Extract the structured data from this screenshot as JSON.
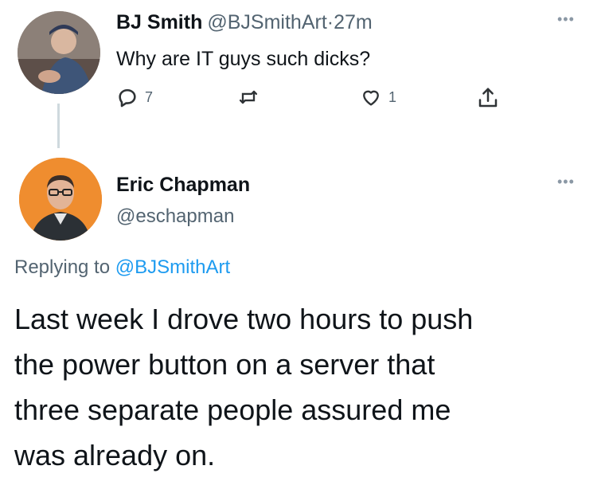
{
  "tweet1": {
    "author_name": "BJ Smith",
    "author_handle": "@BJSmithArt",
    "separator": "·",
    "time": "27m",
    "text": "Why are IT guys such dicks?",
    "more_glyph": "•••",
    "actions": {
      "reply_count": "7",
      "retweet_count": "",
      "like_count": "1",
      "reply_icon": "reply-icon",
      "retweet_icon": "retweet-icon",
      "like_icon": "heart-icon",
      "share_icon": "share-icon"
    }
  },
  "tweet2": {
    "author_name": "Eric Chapman",
    "author_handle": "@eschapman",
    "more_glyph": "•••",
    "replying_prefix": "Replying to",
    "replying_handle": "@BJSmithArt",
    "body_lines": [
      "Last week I drove two hours to push",
      "the power button on a server that",
      "three separate people assured me",
      "was already on."
    ]
  },
  "colors": {
    "text_primary": "#0f1419",
    "text_secondary": "#536471",
    "link": "#1d9bf0",
    "thread_line": "#cfd9de",
    "avatar2_bg": "#ef8d2f"
  }
}
